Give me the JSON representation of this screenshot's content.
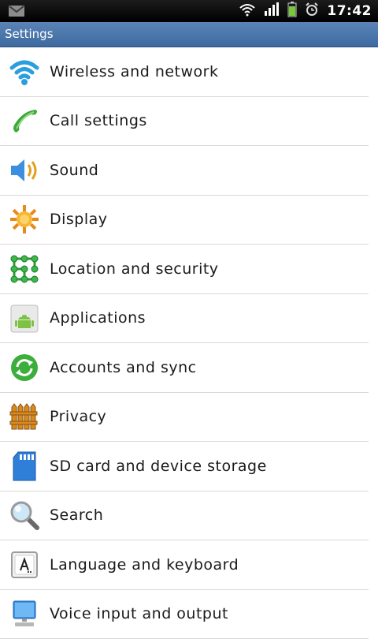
{
  "status_bar": {
    "time": "17:42",
    "icons": [
      "gmail-notification-icon",
      "wifi-icon",
      "signal-icon",
      "battery-icon",
      "alarm-icon"
    ]
  },
  "title_bar": {
    "title": "Settings"
  },
  "settings": {
    "items": [
      {
        "label": "Wireless and network",
        "icon": "wifi-icon"
      },
      {
        "label": "Call settings",
        "icon": "phone-icon"
      },
      {
        "label": "Sound",
        "icon": "speaker-icon"
      },
      {
        "label": "Display",
        "icon": "display-sun-icon"
      },
      {
        "label": "Location and security",
        "icon": "location-grid-icon"
      },
      {
        "label": "Applications",
        "icon": "android-icon"
      },
      {
        "label": "Accounts and sync",
        "icon": "sync-icon"
      },
      {
        "label": "Privacy",
        "icon": "fence-icon"
      },
      {
        "label": "SD card and device storage",
        "icon": "sd-card-icon"
      },
      {
        "label": "Search",
        "icon": "magnifier-icon"
      },
      {
        "label": "Language and keyboard",
        "icon": "keyboard-key-icon"
      },
      {
        "label": "Voice input and output",
        "icon": "monitor-icon"
      }
    ]
  },
  "colors": {
    "title_bar": "#4a76ac",
    "status_bar": "#000000",
    "divider": "#d9d9d9"
  }
}
